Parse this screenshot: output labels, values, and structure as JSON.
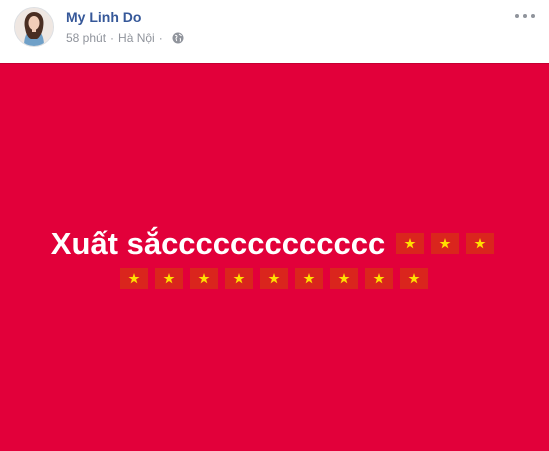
{
  "post": {
    "author_name": "My Linh Do",
    "timestamp": "58 phút",
    "separator": "·",
    "location": "Hà Nội",
    "privacy_icon": "globe-icon",
    "more_icon": "ellipsis-icon",
    "background_color": "#e2003a",
    "text_color": "#ffffff",
    "text": "Xuất sắccccccccccccc",
    "flag_emoji": "flag-vietnam",
    "flags_line1_count": 3,
    "flags_line2_count": 9
  }
}
